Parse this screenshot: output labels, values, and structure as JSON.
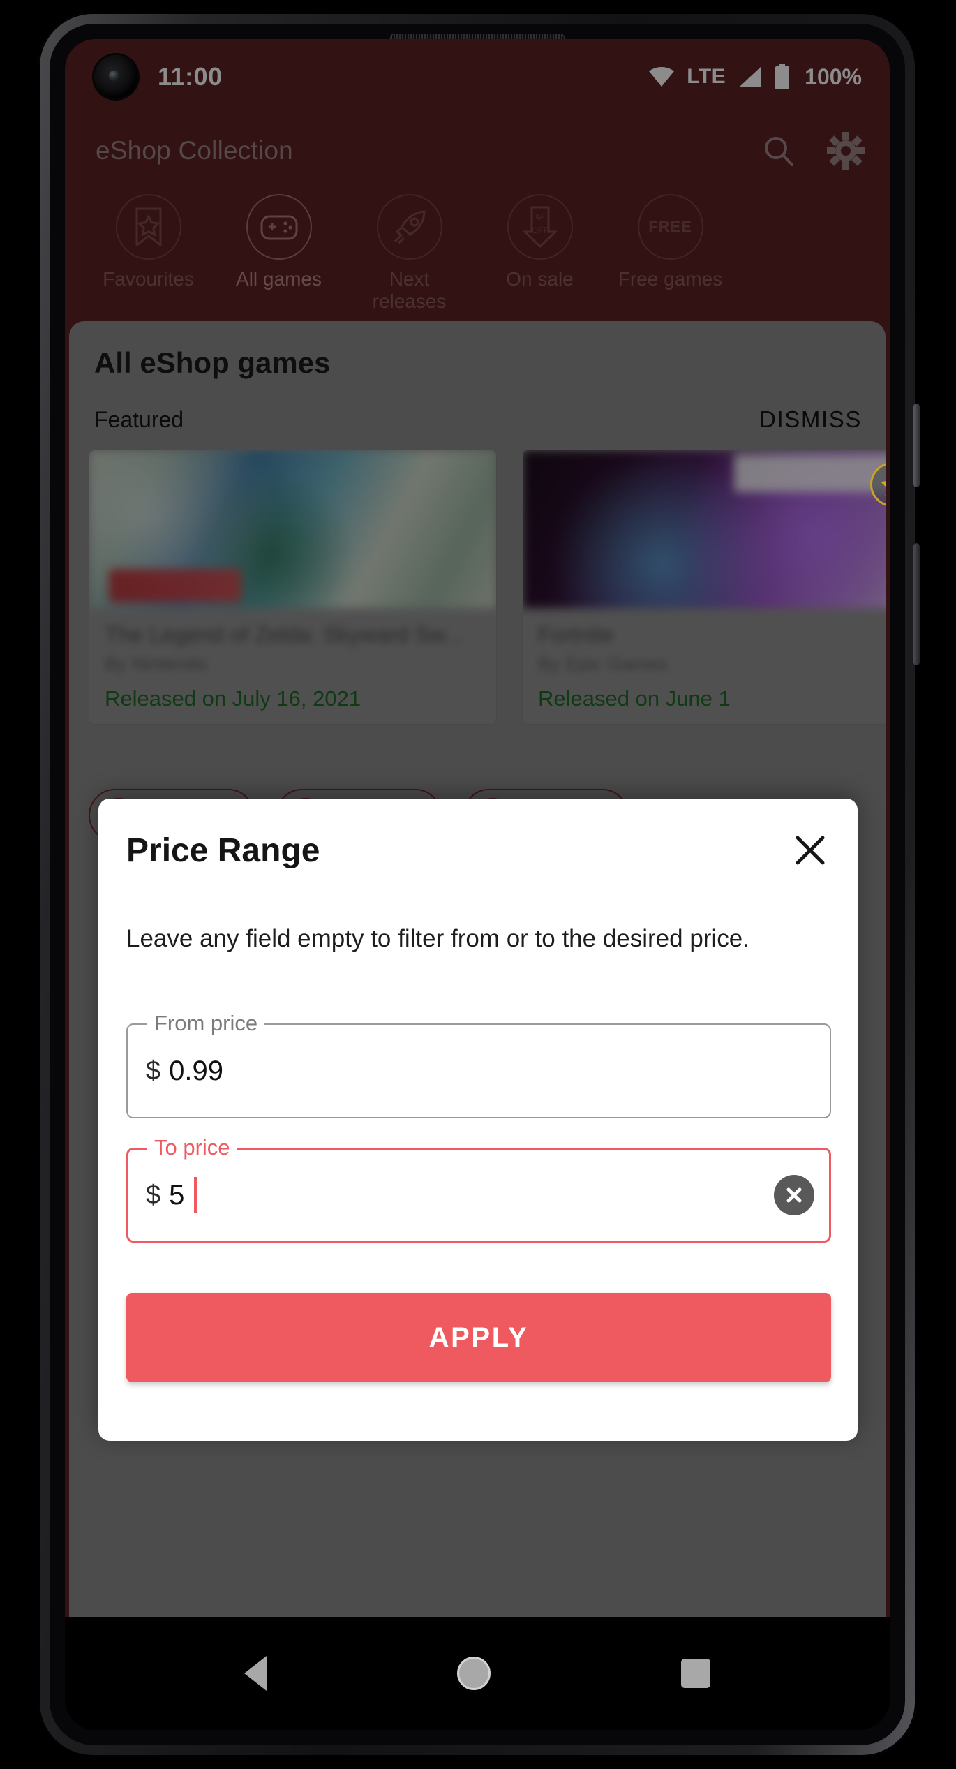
{
  "status_bar": {
    "time": "11:00",
    "network_label": "LTE",
    "battery_percent": "100%",
    "icons": [
      "wifi-icon",
      "cellular-signal-icon",
      "battery-icon"
    ]
  },
  "app_bar": {
    "title": "eShop Collection",
    "actions": [
      {
        "name": "search-icon",
        "label": "Search"
      },
      {
        "name": "gear-icon",
        "label": "Settings"
      }
    ]
  },
  "categories": [
    {
      "label": "Favourites",
      "icon": "bookmark-star-icon",
      "selected": false
    },
    {
      "label": "All games",
      "icon": "gamepad-icon",
      "selected": true
    },
    {
      "label": "Next releases",
      "icon": "rocket-icon",
      "selected": false
    },
    {
      "label": "On sale",
      "icon": "percent-off-tag-icon",
      "selected": false
    },
    {
      "label": "Free games",
      "icon": "free-label-icon",
      "selected": false,
      "badge_text": "FREE"
    }
  ],
  "content": {
    "title": "All eShop games",
    "featured_label": "Featured",
    "dismiss_label": "DISMISS",
    "cards": [
      {
        "title": "The Legend of Zelda: Skyward Sw...",
        "author": "By Nintendo",
        "release": "Released on July 16, 2021",
        "favourite": true
      },
      {
        "title": "Fortnite",
        "author": "By Epic Games",
        "release": "Released on June 1",
        "favourite": false
      }
    ]
  },
  "dialog": {
    "title": "Price Range",
    "close_icon": "close-icon",
    "description": "Leave any field empty to filter from or to the desired price.",
    "fields": [
      {
        "legend": "From price",
        "currency": "$",
        "value": "0.99",
        "focused": false,
        "has_clear": false
      },
      {
        "legend": "To price",
        "currency": "$",
        "value": "5",
        "focused": true,
        "has_clear": true,
        "clear_icon": "clear-circle-icon"
      }
    ],
    "apply_label": "APPLY"
  },
  "nav_bar": {
    "back": "back-triangle-icon",
    "home": "home-circle-icon",
    "recents": "recents-square-icon"
  },
  "colors": {
    "brand_red": "#5e2224",
    "accent_coral": "#ee5a5f",
    "release_green": "#1c6b24",
    "favourite_gold": "#c9a227",
    "sheet_gray": "#8b8b8b"
  }
}
